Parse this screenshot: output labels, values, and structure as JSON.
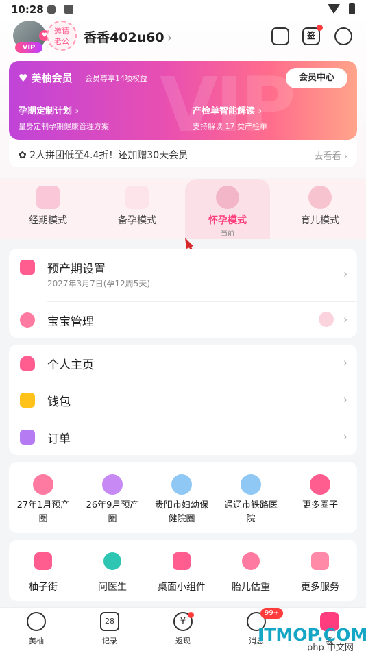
{
  "status": {
    "time": "10:28"
  },
  "profile": {
    "vip": "VIP",
    "invite_line1": "邀请",
    "invite_line2": "老公",
    "username": "香香402u60"
  },
  "top_icons": {
    "sign": "签"
  },
  "member": {
    "title": "美柚会员",
    "subtitle": "会员尊享14项权益",
    "center_button": "会员中心",
    "watermark": "VIP",
    "feature1_title": "孕期定制计划 ›",
    "feature1_desc": "量身定制孕期健康管理方案",
    "feature2_title": "产检单智能解读 ›",
    "feature2_desc": "支持解读 17 类产检单"
  },
  "promo": {
    "text": "2人拼团低至4.4折！还加赠30天会员",
    "more": "去看看 ›"
  },
  "modes": [
    {
      "label": "经期模式"
    },
    {
      "label": "备孕模式"
    },
    {
      "label": "怀孕模式",
      "current": "当前"
    },
    {
      "label": "育儿模式"
    }
  ],
  "pregnancy": {
    "due_label": "预产期设置",
    "due_value": "2027年3月7日(孕12周5天)",
    "baby_label": "宝宝管理"
  },
  "personal": [
    {
      "label": "个人主页"
    },
    {
      "label": "钱包"
    },
    {
      "label": "订单"
    }
  ],
  "groups": [
    {
      "line1": "27年1月预产",
      "line2": "圈"
    },
    {
      "line1": "26年9月预产",
      "line2": "圈"
    },
    {
      "line1": "贵阳市妇幼保",
      "line2": "健院圈"
    },
    {
      "line1": "通辽市铁路医",
      "line2": "院"
    },
    {
      "line1": "更多圈子",
      "line2": ""
    }
  ],
  "services": [
    {
      "label": "柚子街"
    },
    {
      "label": "问医生"
    },
    {
      "label": "桌面小组件"
    },
    {
      "label": "胎儿估重"
    },
    {
      "label": "更多服务"
    }
  ],
  "tabs": [
    {
      "label": "美柚"
    },
    {
      "label": "记录",
      "icon_text": "28"
    },
    {
      "label": "返现",
      "icon_text": "¥"
    },
    {
      "label": "消息",
      "badge": "99+"
    },
    {
      "label": "我"
    }
  ],
  "watermark": {
    "main": "ITMOP.COM",
    "sub": "php 中文网"
  },
  "colors": {
    "accent": "#ff3c7d",
    "member_start": "#c044d8",
    "member_end": "#ffa48a"
  }
}
